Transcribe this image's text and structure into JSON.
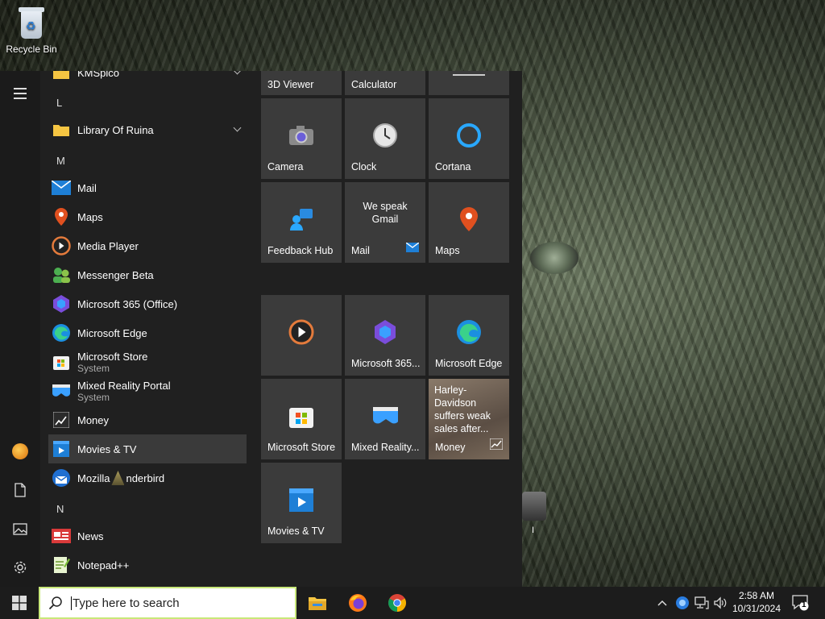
{
  "desktop": {
    "recycle_bin_label": "Recycle Bin",
    "partial_text": "I"
  },
  "start_menu": {
    "app_list": {
      "top_partial": "KMSpico",
      "letter_l": "L",
      "letter_m": "M",
      "letter_n": "N",
      "items": [
        {
          "label": "Library Of Ruina",
          "sub": ""
        },
        {
          "label": "Mail",
          "sub": ""
        },
        {
          "label": "Maps",
          "sub": ""
        },
        {
          "label": "Media Player",
          "sub": ""
        },
        {
          "label": "Messenger Beta",
          "sub": ""
        },
        {
          "label": "Microsoft 365 (Office)",
          "sub": ""
        },
        {
          "label": "Microsoft Edge",
          "sub": ""
        },
        {
          "label": "Microsoft Store",
          "sub": "System"
        },
        {
          "label": "Mixed Reality Portal",
          "sub": "System"
        },
        {
          "label": "Money",
          "sub": ""
        },
        {
          "label": "Movies & TV",
          "sub": ""
        },
        {
          "label": "Mozilla",
          "sub": "",
          "tail": "nderbird"
        },
        {
          "label": "News",
          "sub": ""
        },
        {
          "label": "Notepad++",
          "sub": ""
        }
      ]
    },
    "tiles": {
      "row0": [
        "3D Viewer",
        "Calculator"
      ],
      "camera": "Camera",
      "clock": "Clock",
      "cortana": "Cortana",
      "feedback_hub": "Feedback Hub",
      "mail": "Mail",
      "mail_live_line1": "We speak",
      "mail_live_line2": "Gmail",
      "maps": "Maps",
      "m365": "Microsoft 365...",
      "edge": "Microsoft Edge",
      "store": "Microsoft Store",
      "mixed_reality": "Mixed Reality...",
      "money": "Money",
      "money_news": "Harley-Davidson suffers weak sales after...",
      "movies": "Movies & TV"
    }
  },
  "taskbar": {
    "search_placeholder": "Type here to search",
    "time": "2:58 AM",
    "date": "10/31/2024",
    "notification_count": "1"
  },
  "colors": {
    "start_bg": "#202020",
    "tile_bg": "#3b3b3b",
    "taskbar_bg": "#1c1c1c",
    "search_border": "#c8e87a"
  }
}
